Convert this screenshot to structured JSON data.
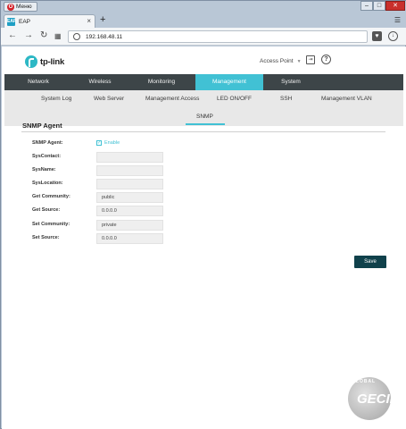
{
  "browser": {
    "menu_label": "Меню",
    "tab_label": "EAP",
    "favicon_text": "EAP",
    "url": "192.168.48.11"
  },
  "header": {
    "mode": "Access Point"
  },
  "main_nav": [
    "Network",
    "Wireless",
    "Monitoring",
    "Management",
    "System"
  ],
  "main_nav_active": "Management",
  "sub_nav": [
    "System Log",
    "Web Server",
    "Management Access",
    "LED ON/OFF",
    "SSH",
    "Management VLAN"
  ],
  "sub_nav_active": "SNMP",
  "section": {
    "title": "SNMP Agent"
  },
  "form": {
    "agent": {
      "label": "SNMP Agent:",
      "checkbox_label": "Enable",
      "checked": true
    },
    "sys_contact": {
      "label": "SysContact:",
      "value": ""
    },
    "sys_name": {
      "label": "SysName:",
      "value": ""
    },
    "sys_location": {
      "label": "SysLocation:",
      "value": ""
    },
    "get_community": {
      "label": "Get Community:",
      "value": "public"
    },
    "get_source": {
      "label": "Get Source:",
      "value": "0.0.0.0"
    },
    "set_community": {
      "label": "Set Community:",
      "value": "private"
    },
    "set_source": {
      "label": "Set Source:",
      "value": "0.0.0.0"
    }
  },
  "save_label": "Save",
  "watermark": {
    "arc": "GLOBAL",
    "big": "GECID"
  }
}
